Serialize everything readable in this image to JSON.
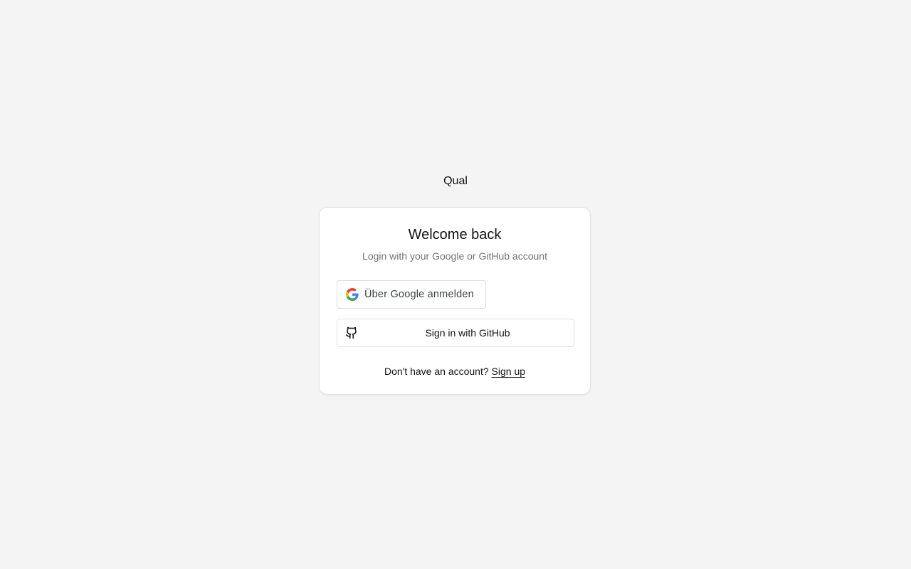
{
  "app": {
    "brand": "Qual"
  },
  "login_card": {
    "title": "Welcome back",
    "subtitle": "Login with your Google or GitHub account",
    "google_button": {
      "label": "Über Google anmelden",
      "icon": "google-logo-icon"
    },
    "github_button": {
      "label": "Sign in with GitHub",
      "icon": "github-logo-icon"
    },
    "signup_prompt": "Don't have an account?",
    "signup_link": "Sign up"
  },
  "colors": {
    "page_background": "#f4f4f4",
    "card_background": "#ffffff",
    "subtitle_text": "#737373",
    "google_blue": "#4285F4",
    "google_red": "#EA4335",
    "google_yellow": "#FBBC05",
    "google_green": "#34A853"
  }
}
